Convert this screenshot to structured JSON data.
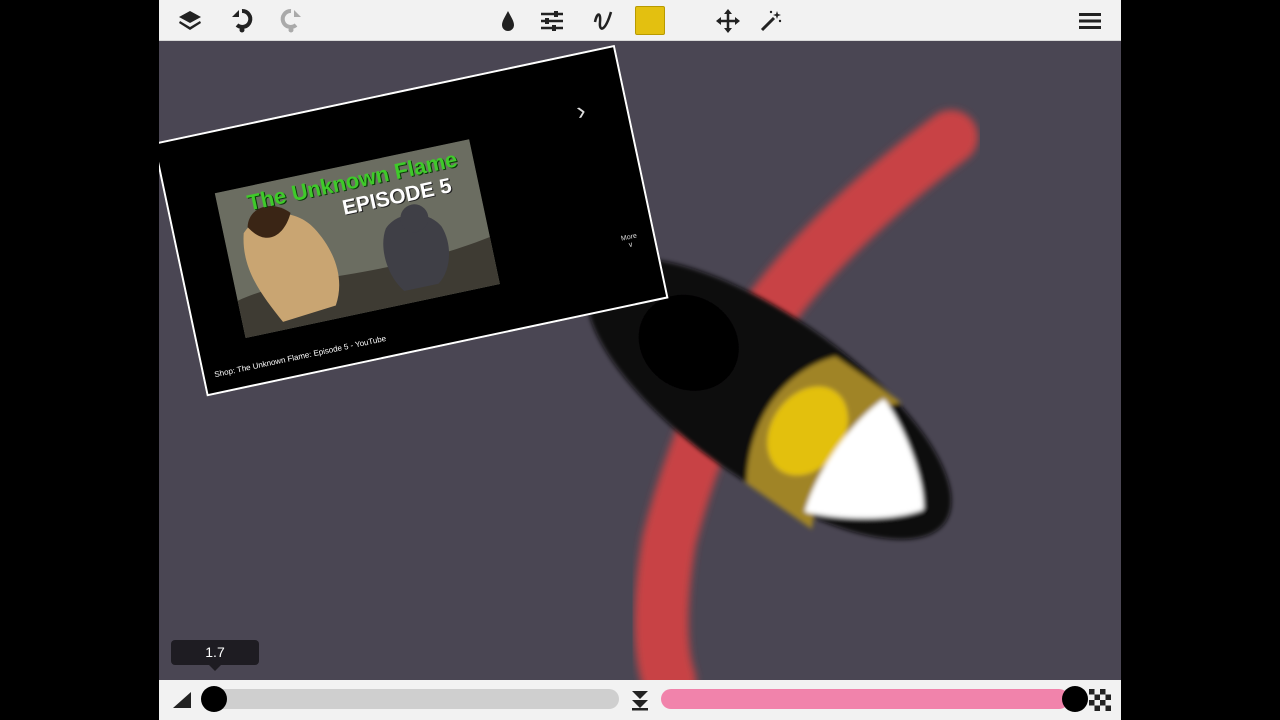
{
  "toolbar": {
    "icons": [
      "layers-icon",
      "undo-icon",
      "redo-icon",
      "brush-icon",
      "adjust-icon",
      "stroke-icon",
      "color-swatch",
      "move-icon",
      "magic-wand-icon",
      "menu-icon"
    ],
    "color": "#e3c010"
  },
  "reference": {
    "thumb_title_line1": "The Unknown Flame",
    "thumb_title_line2": "EPISODE 5",
    "caption": "Shop: The Unknown Flame: Episode 5 - YouTube",
    "more": "More"
  },
  "zoom": {
    "value": "1.7"
  },
  "bottom": {
    "size_level": 0.0,
    "opacity_level": 1.0,
    "icons": [
      "brush-size-icon",
      "swap-icon",
      "transparency-icon"
    ]
  },
  "colors": {
    "canvas": "#4a4653",
    "brush": "#e3c010",
    "stroke_red": "#c84245",
    "opacity_track": "#f183ab"
  }
}
